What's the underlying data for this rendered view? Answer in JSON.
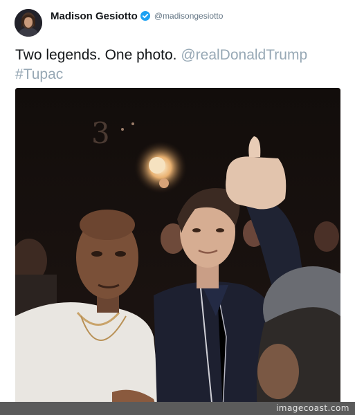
{
  "user": {
    "display_name": "Madison Gesiotto",
    "handle": "@madisongesiotto",
    "verified": true,
    "avatar_icon": "profile-photo"
  },
  "tweet": {
    "text_plain": "Two legends. One photo.",
    "mention": "@realDonaldTrump",
    "hashtag": "#Tupac"
  },
  "media": {
    "type": "photo",
    "icon": "photo-image"
  },
  "watermark": "imagecoast.com",
  "colors": {
    "link": "#97a8b5",
    "text": "#14171a",
    "handle": "#657786",
    "verified": "#1da1f2",
    "watermark_bar": "#5b5b5b"
  }
}
